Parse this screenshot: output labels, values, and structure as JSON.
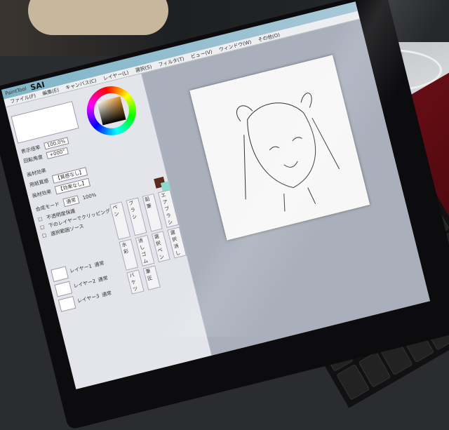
{
  "app": {
    "title_prefix": "PaintTool",
    "logo": "SAI"
  },
  "menu": [
    "ファイル(F)",
    "編集(E)",
    "キャンバス(C)",
    "レイヤー(L)",
    "選択(S)",
    "フィルタ(T)",
    "ビュー(V)",
    "ウィンドウ(W)",
    "その他(O)"
  ],
  "nav": {
    "zoom_label": "表示倍率",
    "zoom_value": "100.0%",
    "rotate_label": "回転角度",
    "rotate_value": "+000°"
  },
  "panel": {
    "effect_label": "画材効果",
    "paper_label": "用紙質感",
    "paper_value": "【質感なし】",
    "effect2_value": "【効果なし】",
    "blend_label": "合成モード",
    "blend_value": "通常",
    "opacity_value": "100%",
    "protect_label": "不透明度保護",
    "clip_label": "下のレイヤーでクリッピング",
    "source_label": "選択範囲ソース"
  },
  "tools": [
    "ペン",
    "ブラシ",
    "鉛筆",
    "エアブラシ",
    "水彩",
    "消しゴム",
    "選択ペン",
    "選択消し",
    "バケツ",
    "筆圧"
  ],
  "layers": [
    {
      "name": "レイヤー1",
      "mode": "通常"
    },
    {
      "name": "レイヤー2",
      "mode": "通常"
    },
    {
      "name": "レイヤー3",
      "mode": "通常"
    }
  ],
  "colors": {
    "primary": "#5a2a1c",
    "secondary": "#8fd8cc",
    "bezel": "#0c0c0e",
    "laptop_body": "#7a0f18"
  }
}
